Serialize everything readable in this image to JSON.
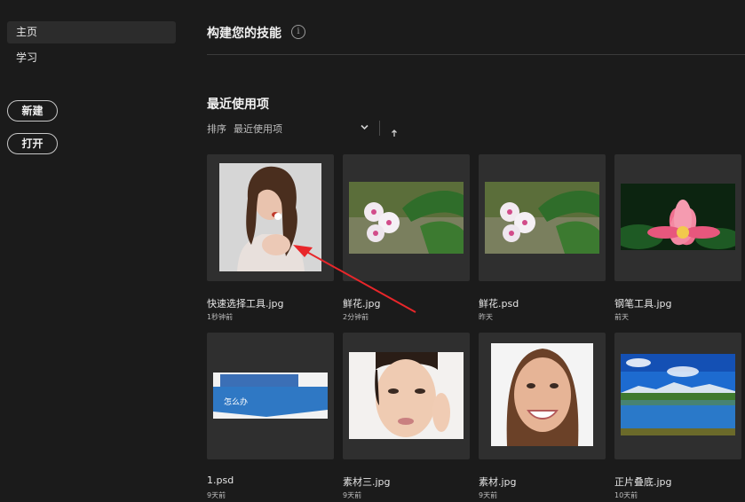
{
  "sidebar": {
    "items": [
      {
        "label": "主页",
        "active": true
      },
      {
        "label": "学习",
        "active": false
      }
    ],
    "new_label": "新建",
    "open_label": "打开"
  },
  "main": {
    "skills_title": "构建您的技能",
    "info_icon": "i",
    "recent_title": "最近使用项",
    "sort_label": "排序",
    "sort_value": "最近使用项",
    "sort_dropdown_icon": "chevron-down-icon",
    "sort_direction_icon": "arrow-up-icon",
    "files": [
      {
        "name": "快速选择工具.jpg",
        "time": "1秒钟前",
        "thumb": "woman-portrait"
      },
      {
        "name": "鲜花.jpg",
        "time": "2分钟前",
        "thumb": "white-flowers"
      },
      {
        "name": "鲜花.psd",
        "time": "昨天",
        "thumb": "white-flowers"
      },
      {
        "name": "钢笔工具.jpg",
        "time": "前天",
        "thumb": "pink-lotus"
      },
      {
        "name": "1.psd",
        "time": "9天前",
        "thumb": "blue-banner",
        "thumb_text": "怎么办"
      },
      {
        "name": "素材三.jpg",
        "time": "9天前",
        "thumb": "face-closeup"
      },
      {
        "name": "素材.jpg",
        "time": "9天前",
        "thumb": "smiling-woman"
      },
      {
        "name": "正片叠底.jpg",
        "time": "10天前",
        "thumb": "lake-landscape"
      }
    ]
  },
  "colors": {
    "background": "#1b1b1b",
    "card": "#2f2f2f",
    "annotation_arrow": "#e8262a"
  }
}
